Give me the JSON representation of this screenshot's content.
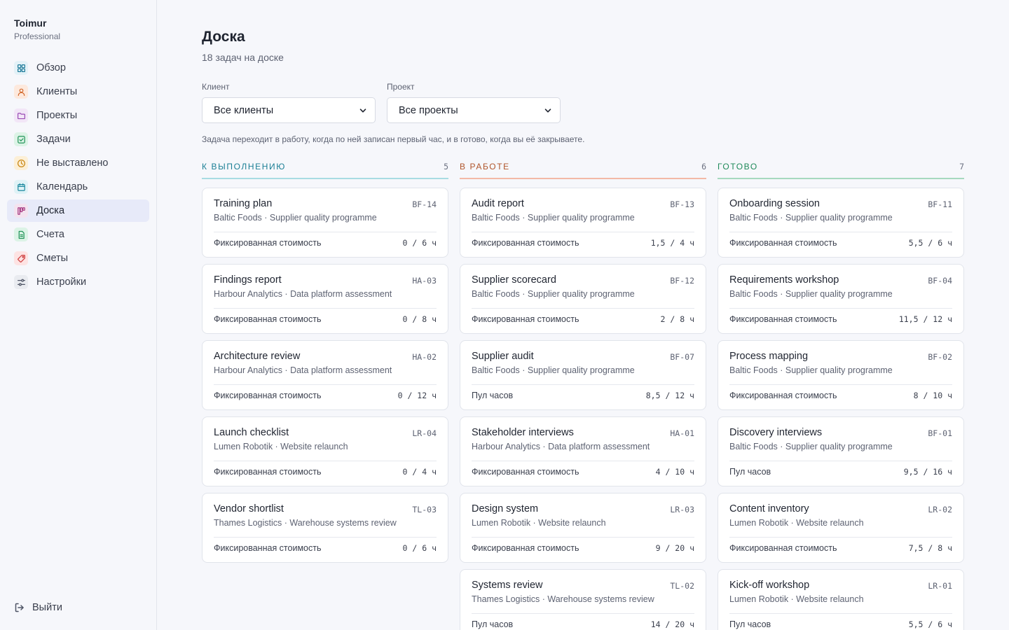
{
  "sidebar": {
    "brand_name": "Toimur",
    "brand_plan": "Professional",
    "items": [
      {
        "label": "Обзор",
        "icon": "grid-icon",
        "icon_bg": "#e3f1f7",
        "icon_color": "#1d7a99"
      },
      {
        "label": "Клиенты",
        "icon": "user-icon",
        "icon_bg": "#fde9dd",
        "icon_color": "#d2672a"
      },
      {
        "label": "Проекты",
        "icon": "folder-icon",
        "icon_bg": "#f2e6f7",
        "icon_color": "#9a4bb5"
      },
      {
        "label": "Задачи",
        "icon": "check-square-icon",
        "icon_bg": "#dcf3e6",
        "icon_color": "#23945a"
      },
      {
        "label": "Не выставлено",
        "icon": "clock-icon",
        "icon_bg": "#fcefd6",
        "icon_color": "#c98612"
      },
      {
        "label": "Календарь",
        "icon": "calendar-icon",
        "icon_bg": "#dff2f6",
        "icon_color": "#1e8aa0"
      },
      {
        "label": "Доска",
        "icon": "kanban-icon",
        "icon_bg": "#f4e3ef",
        "icon_color": "#a63b82",
        "active": true
      },
      {
        "label": "Счета",
        "icon": "invoice-icon",
        "icon_bg": "#dcf3e6",
        "icon_color": "#23945a"
      },
      {
        "label": "Сметы",
        "icon": "tag-icon",
        "icon_bg": "#fde3e3",
        "icon_color": "#cf3f3f"
      },
      {
        "label": "Настройки",
        "icon": "sliders-icon",
        "icon_bg": "#e9ebf0",
        "icon_color": "#4f5566"
      }
    ],
    "logout_label": "Выйти"
  },
  "header": {
    "title": "Доска",
    "subtitle": "18 задач на доске"
  },
  "filters": {
    "client_label": "Клиент",
    "client_value": "Все клиенты",
    "project_label": "Проект",
    "project_value": "Все проекты"
  },
  "hint": "Задача переходит в работу, когда по ней записан первый час, и в готово, когда вы её закрываете.",
  "columns": [
    {
      "title": "К ВЫПОЛНЕНИЮ",
      "count": "5",
      "color": "#1b7f95",
      "line": "#a8dce3",
      "cards": [
        {
          "title": "Training plan",
          "code": "BF-14",
          "sub": "Baltic Foods · Supplier quality programme",
          "type": "Фиксированная стоимость",
          "hours": "0 / 6 ч"
        },
        {
          "title": "Findings report",
          "code": "HA-03",
          "sub": "Harbour Analytics · Data platform assessment",
          "type": "Фиксированная стоимость",
          "hours": "0 / 8 ч"
        },
        {
          "title": "Architecture review",
          "code": "HA-02",
          "sub": "Harbour Analytics · Data platform assessment",
          "type": "Фиксированная стоимость",
          "hours": "0 / 12 ч"
        },
        {
          "title": "Launch checklist",
          "code": "LR-04",
          "sub": "Lumen Robotik · Website relaunch",
          "type": "Фиксированная стоимость",
          "hours": "0 / 4 ч"
        },
        {
          "title": "Vendor shortlist",
          "code": "TL-03",
          "sub": "Thames Logistics · Warehouse systems review",
          "type": "Фиксированная стоимость",
          "hours": "0 / 6 ч"
        }
      ]
    },
    {
      "title": "В РАБОТЕ",
      "count": "6",
      "color": "#b0552b",
      "line": "#f3b9a6",
      "cards": [
        {
          "title": "Audit report",
          "code": "BF-13",
          "sub": "Baltic Foods · Supplier quality programme",
          "type": "Фиксированная стоимость",
          "hours": "1,5 / 4 ч"
        },
        {
          "title": "Supplier scorecard",
          "code": "BF-12",
          "sub": "Baltic Foods · Supplier quality programme",
          "type": "Фиксированная стоимость",
          "hours": "2 / 8 ч"
        },
        {
          "title": "Supplier audit",
          "code": "BF-07",
          "sub": "Baltic Foods · Supplier quality programme",
          "type": "Пул часов",
          "hours": "8,5 / 12 ч"
        },
        {
          "title": "Stakeholder interviews",
          "code": "HA-01",
          "sub": "Harbour Analytics · Data platform assessment",
          "type": "Фиксированная стоимость",
          "hours": "4 / 10 ч"
        },
        {
          "title": "Design system",
          "code": "LR-03",
          "sub": "Lumen Robotik · Website relaunch",
          "type": "Фиксированная стоимость",
          "hours": "9 / 20 ч"
        },
        {
          "title": "Systems review",
          "code": "TL-02",
          "sub": "Thames Logistics · Warehouse systems review",
          "type": "Пул часов",
          "hours": "14 / 20 ч"
        }
      ]
    },
    {
      "title": "ГОТОВО",
      "count": "7",
      "color": "#1f8a5a",
      "line": "#a6d9bf",
      "cards": [
        {
          "title": "Onboarding session",
          "code": "BF-11",
          "sub": "Baltic Foods · Supplier quality programme",
          "type": "Фиксированная стоимость",
          "hours": "5,5 / 6 ч"
        },
        {
          "title": "Requirements workshop",
          "code": "BF-04",
          "sub": "Baltic Foods · Supplier quality programme",
          "type": "Фиксированная стоимость",
          "hours": "11,5 / 12 ч"
        },
        {
          "title": "Process mapping",
          "code": "BF-02",
          "sub": "Baltic Foods · Supplier quality programme",
          "type": "Фиксированная стоимость",
          "hours": "8 / 10 ч"
        },
        {
          "title": "Discovery interviews",
          "code": "BF-01",
          "sub": "Baltic Foods · Supplier quality programme",
          "type": "Пул часов",
          "hours": "9,5 / 16 ч"
        },
        {
          "title": "Content inventory",
          "code": "LR-02",
          "sub": "Lumen Robotik · Website relaunch",
          "type": "Фиксированная стоимость",
          "hours": "7,5 / 8 ч"
        },
        {
          "title": "Kick-off workshop",
          "code": "LR-01",
          "sub": "Lumen Robotik · Website relaunch",
          "type": "Пул часов",
          "hours": "5,5 / 6 ч"
        }
      ]
    }
  ]
}
